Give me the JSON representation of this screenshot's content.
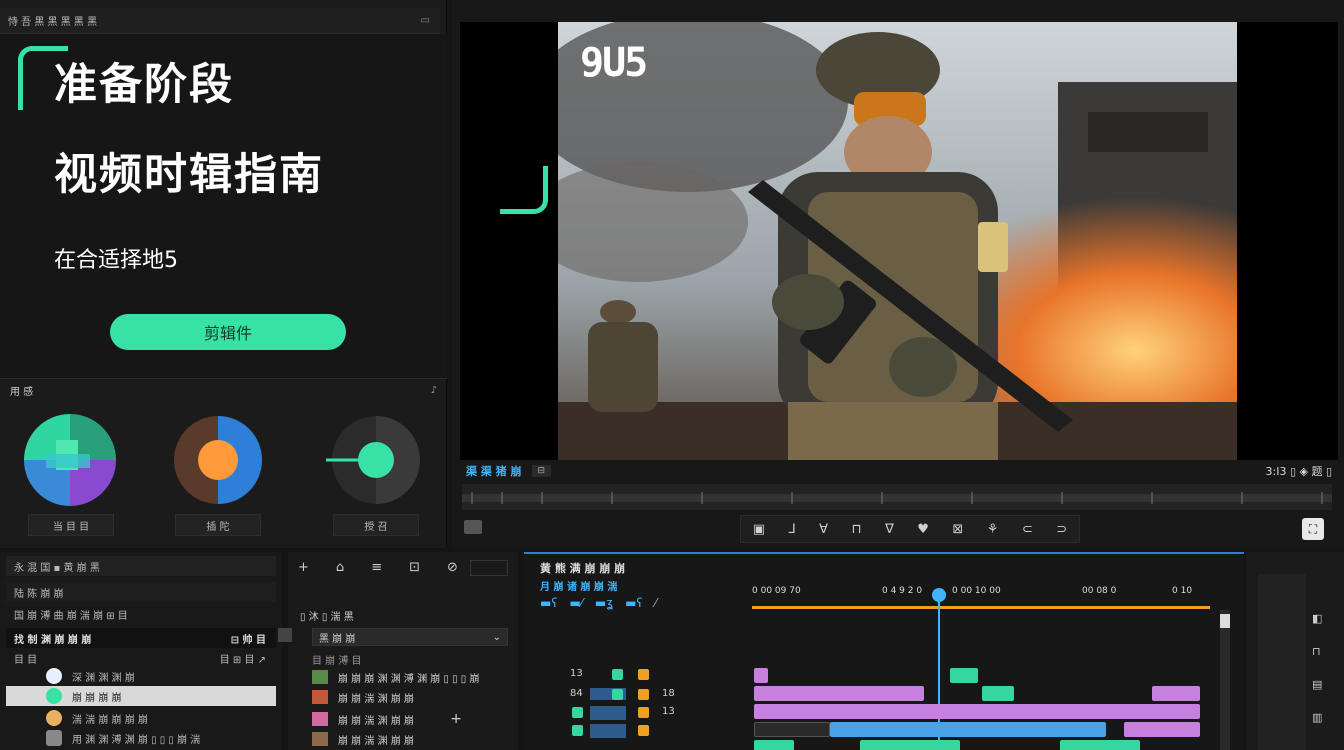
{
  "left_panel": {
    "tab_title": "恃 吾 黑 黑 黑 黑 黑",
    "title_line1": "准备阶段",
    "title_line2": "视频时辑指南",
    "subtitle": "在合适择地5",
    "cta_label": "剪辑件",
    "scopes_header": "用 感",
    "scope_labels": [
      "当 目 目",
      "插 陀",
      "授 召"
    ]
  },
  "preview": {
    "overlay_text": "9U5",
    "bar_title": "渠 渠 猪 崩",
    "bar_small": "⊟",
    "timecode": "3:I3 ▯ ◈ 题 ▯"
  },
  "toolbar": {
    "icons": [
      "▣",
      "⅃",
      "∀",
      "⊓",
      "∇",
      "♥",
      "⊠",
      "⚘",
      "⊂",
      "⊃"
    ]
  },
  "project_panel": {
    "header": "永 混 国 ▪ 黄 崩 黑",
    "row1": "陆 陈 崩 崩",
    "row2": "国 崩 溥 曲 崩 湍 崩  ⊞ 目",
    "row3": "找 制 渊 崩 崩 崩",
    "row3_right": "⊟ 帅 目",
    "row4": "目   目",
    "row4_right": "目 ⊞ 目 ↗",
    "items": [
      "深 渊 渊 渊 崩",
      "崩 崩 崩 崩",
      "湍 湍 崩 崩 崩 崩",
      "用 渊 渊 溥 渊 崩 ▯ ▯ ▯ 崩 湍"
    ]
  },
  "media_panel": {
    "tools": [
      "+",
      "⌂",
      "≡",
      "⊡",
      "⊘"
    ],
    "section": "▯ 沐 ▯ 湍 黑",
    "dropdown": "黑 崩 崩",
    "subhead": "目 崩 溥 目",
    "items": [
      "崩 崩 崩 渊 渊 溥 渊 崩 ▯ ▯ ▯ 崩",
      "崩 崩 湍 渊 崩 崩",
      "崩 崩 湍 渊 崩 崩",
      "崩 崩 湍 渊 崩 崩"
    ]
  },
  "timeline": {
    "title": "黄 熊 满 崩 崩 崩",
    "subtitle": "月 崩 诸 崩 崩 湍",
    "ruler_labels": [
      "0 00 09 70",
      "0 4 9 2 0",
      "0 00 10 00",
      "00 08 0",
      "0 10"
    ],
    "track_numbers": [
      "13",
      "84",
      "13",
      "18"
    ]
  },
  "colors": {
    "accent": "#38e2a6",
    "timeline_blue": "#4aa3e8",
    "timeline_purple": "#c77fe0",
    "playhead": "#3fb4ff",
    "ruler_orange": "#f0a020"
  }
}
